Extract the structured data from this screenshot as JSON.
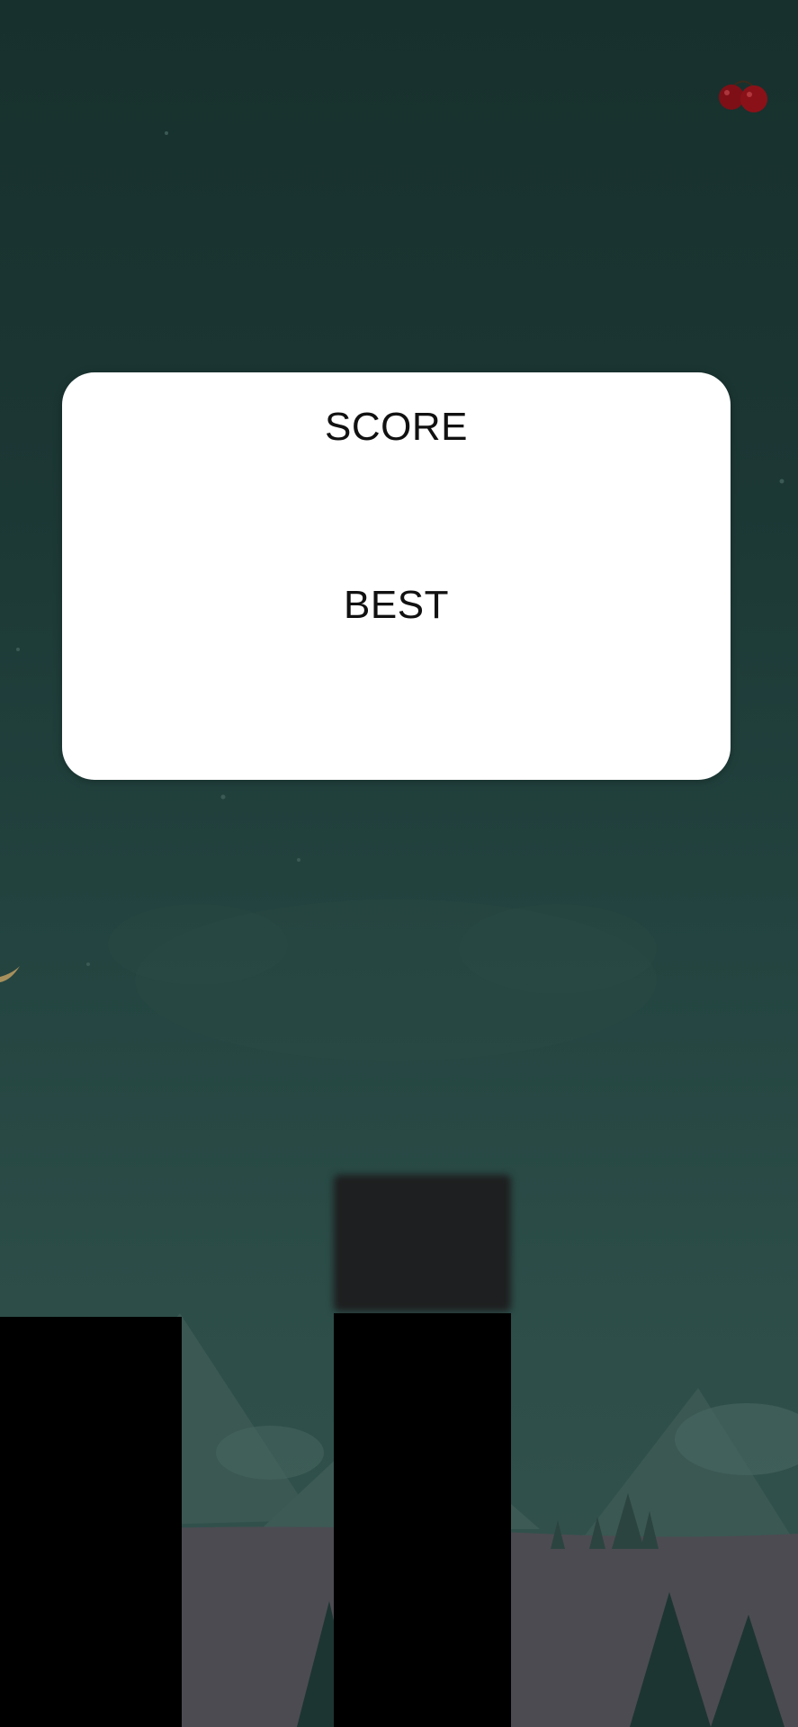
{
  "game": {
    "cherry_icon": "cherry-icon"
  },
  "modal": {
    "score_label": "SCORE",
    "score_value": "",
    "best_label": "BEST",
    "best_value": ""
  },
  "colors": {
    "sky_top": "#17302d",
    "sky_bottom": "#35534f",
    "modal_bg": "#ffffff",
    "pillar": "#000000",
    "cherry": "#8b1118"
  }
}
